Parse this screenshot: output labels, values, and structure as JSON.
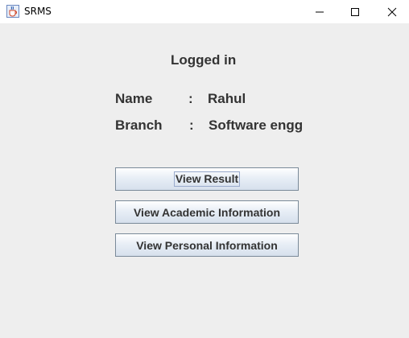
{
  "window": {
    "title": "SRMS",
    "icon": "java-cup-icon"
  },
  "main": {
    "heading": "Logged in",
    "fields": [
      {
        "label": "Name",
        "separator": ":",
        "value": "Rahul"
      },
      {
        "label": "Branch",
        "separator": ":",
        "value": "Software engg"
      }
    ],
    "buttons": [
      {
        "label": "View Result",
        "focused": true
      },
      {
        "label": "View Academic Information",
        "focused": false
      },
      {
        "label": "View Personal Information",
        "focused": false
      }
    ]
  },
  "colors": {
    "background": "#eeeeee",
    "text": "#333333",
    "button_border": "#7a8a99"
  }
}
